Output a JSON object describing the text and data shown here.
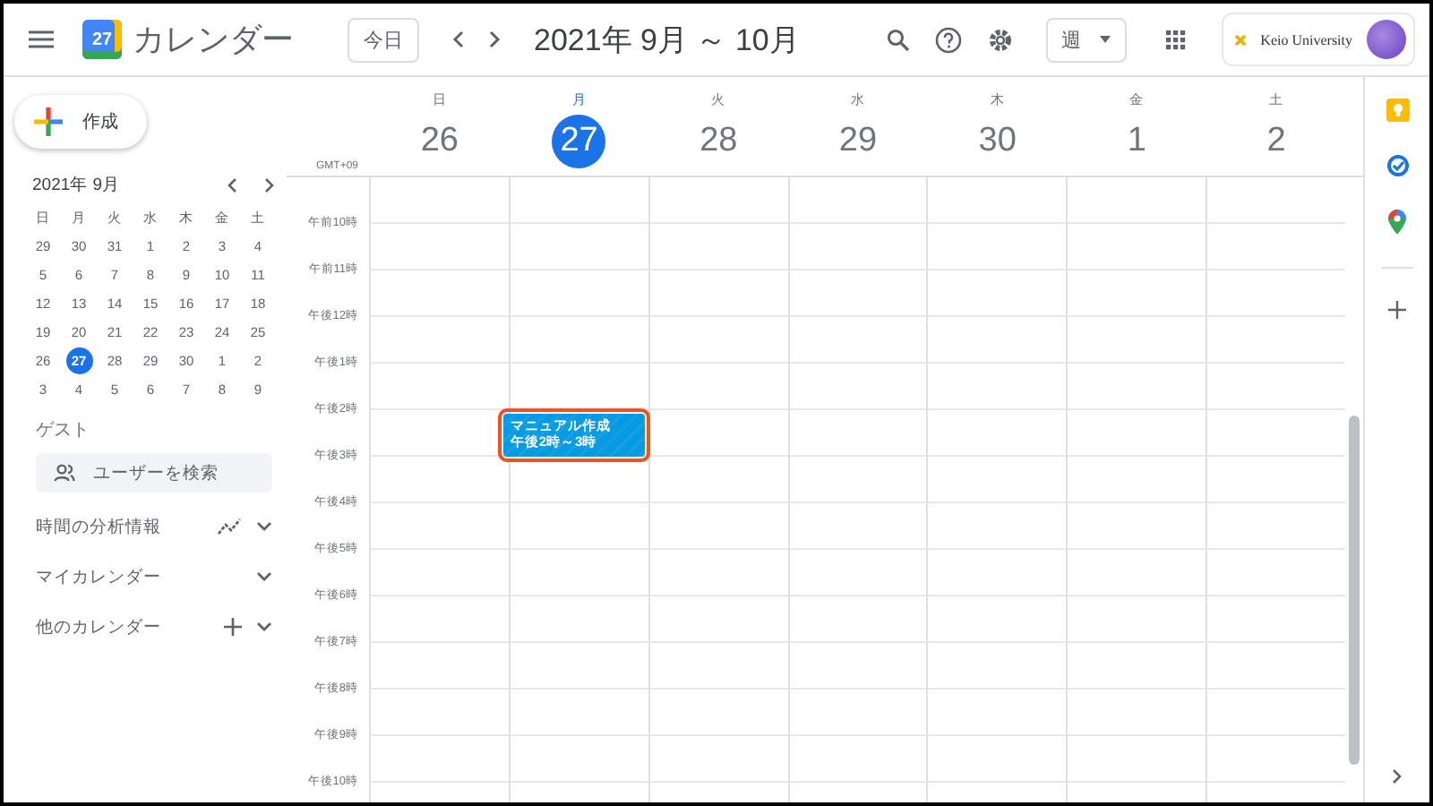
{
  "header": {
    "app_name": "カレンダー",
    "logo_day": "27",
    "today_button": "今日",
    "date_range": "2021年 9月 ～ 10月",
    "view_select": "週",
    "account_label": "Keio University"
  },
  "create_button": "作成",
  "mini_calendar": {
    "title": "2021年 9月",
    "weekdays": [
      "日",
      "月",
      "火",
      "水",
      "木",
      "金",
      "土"
    ],
    "weeks": [
      [
        {
          "day": "29",
          "selected": false
        },
        {
          "day": "30",
          "selected": false
        },
        {
          "day": "31",
          "selected": false
        },
        {
          "day": "1",
          "selected": false
        },
        {
          "day": "2",
          "selected": false
        },
        {
          "day": "3",
          "selected": false
        },
        {
          "day": "4",
          "selected": false
        }
      ],
      [
        {
          "day": "5",
          "selected": false
        },
        {
          "day": "6",
          "selected": false
        },
        {
          "day": "7",
          "selected": false
        },
        {
          "day": "8",
          "selected": false
        },
        {
          "day": "9",
          "selected": false
        },
        {
          "day": "10",
          "selected": false
        },
        {
          "day": "11",
          "selected": false
        }
      ],
      [
        {
          "day": "12",
          "selected": false
        },
        {
          "day": "13",
          "selected": false
        },
        {
          "day": "14",
          "selected": false
        },
        {
          "day": "15",
          "selected": false
        },
        {
          "day": "16",
          "selected": false
        },
        {
          "day": "17",
          "selected": false
        },
        {
          "day": "18",
          "selected": false
        }
      ],
      [
        {
          "day": "19",
          "selected": false
        },
        {
          "day": "20",
          "selected": false
        },
        {
          "day": "21",
          "selected": false
        },
        {
          "day": "22",
          "selected": false
        },
        {
          "day": "23",
          "selected": false
        },
        {
          "day": "24",
          "selected": false
        },
        {
          "day": "25",
          "selected": false
        }
      ],
      [
        {
          "day": "26",
          "selected": false
        },
        {
          "day": "27",
          "selected": true
        },
        {
          "day": "28",
          "selected": false
        },
        {
          "day": "29",
          "selected": false
        },
        {
          "day": "30",
          "selected": false
        },
        {
          "day": "1",
          "selected": false
        },
        {
          "day": "2",
          "selected": false
        }
      ],
      [
        {
          "day": "3",
          "selected": false
        },
        {
          "day": "4",
          "selected": false
        },
        {
          "day": "5",
          "selected": false
        },
        {
          "day": "6",
          "selected": false
        },
        {
          "day": "7",
          "selected": false
        },
        {
          "day": "8",
          "selected": false
        },
        {
          "day": "9",
          "selected": false
        }
      ]
    ]
  },
  "guests": {
    "title": "ゲスト",
    "search_placeholder": "ユーザーを検索"
  },
  "sections": [
    {
      "label": "時間の分析情報",
      "kind": "insights"
    },
    {
      "label": "マイカレンダー",
      "kind": "plain"
    },
    {
      "label": "他のカレンダー",
      "kind": "add"
    }
  ],
  "week": {
    "timezone": "GMT+09",
    "days": [
      {
        "weekday": "日",
        "date": "26",
        "selected": false
      },
      {
        "weekday": "月",
        "date": "27",
        "selected": true,
        "events": [
          {
            "title": "マニュアル作成",
            "time": "午後2時～3時",
            "highlighted": true
          }
        ]
      },
      {
        "weekday": "火",
        "date": "28",
        "selected": false
      },
      {
        "weekday": "水",
        "date": "29",
        "selected": false
      },
      {
        "weekday": "木",
        "date": "30",
        "selected": false
      },
      {
        "weekday": "金",
        "date": "1",
        "selected": false
      },
      {
        "weekday": "土",
        "date": "2",
        "selected": false
      }
    ],
    "hours": [
      "午前10時",
      "午前11時",
      "午後12時",
      "午後1時",
      "午後2時",
      "午後3時",
      "午後4時",
      "午後5時",
      "午後6時",
      "午後7時",
      "午後8時",
      "午後9時",
      "午後10時"
    ]
  }
}
